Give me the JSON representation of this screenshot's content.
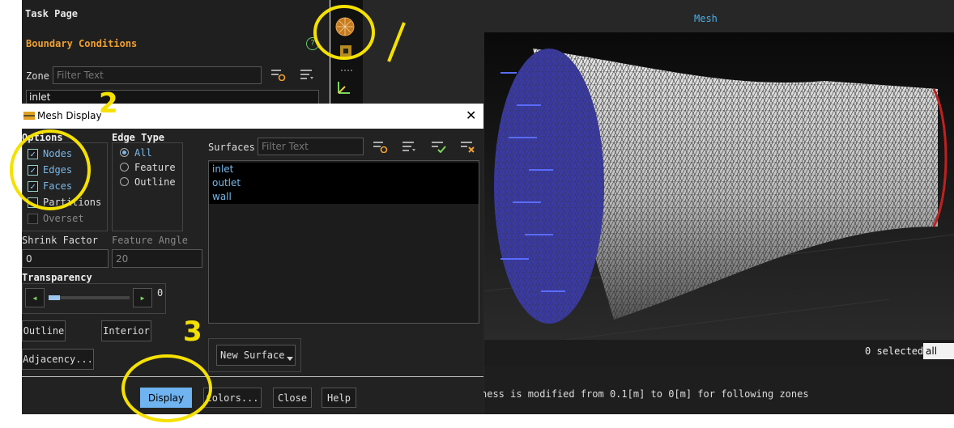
{
  "task_page": {
    "title": "Task Page",
    "section_title": "Boundary Conditions",
    "help_glyph": "?",
    "zone_label": "Zone",
    "zone_filter_placeholder": "Filter Text",
    "zone_list": [
      "inlet"
    ]
  },
  "graphics": {
    "title": "Mesh",
    "selected_text": "0 selected",
    "selection_filter": "all",
    "console_line": "ness is modified from 0.1[m] to 0[m] for following zones"
  },
  "dialog": {
    "title": "Mesh Display",
    "close_glyph": "✕",
    "options": {
      "label": "Options",
      "items": [
        {
          "label": "Nodes",
          "checked": true
        },
        {
          "label": "Edges",
          "checked": true
        },
        {
          "label": "Faces",
          "checked": true
        },
        {
          "label": "Partitions",
          "checked": false
        },
        {
          "label": "Overset",
          "checked": false
        }
      ]
    },
    "edge_type": {
      "label": "Edge Type",
      "items": [
        {
          "label": "All",
          "selected": true
        },
        {
          "label": "Feature",
          "selected": false
        },
        {
          "label": "Outline",
          "selected": false
        }
      ]
    },
    "shrink_factor": {
      "label": "Shrink Factor",
      "value": "0"
    },
    "feature_angle": {
      "label": "Feature Angle",
      "value": "20"
    },
    "transparency": {
      "label": "Transparency",
      "value": "0",
      "level": 0
    },
    "buttons": {
      "outline": "Outline",
      "interior": "Interior",
      "adjacency": "Adjacency...",
      "new_surface": "New Surface",
      "display": "Display",
      "colors": "Colors...",
      "close": "Close",
      "help": "Help"
    },
    "surfaces": {
      "label": "Surfaces",
      "filter_placeholder": "Filter Text",
      "items": [
        "inlet",
        "outlet",
        "wall"
      ]
    }
  },
  "annotations": [
    "1",
    "2",
    "3"
  ],
  "colors": {
    "accent": "#6fb3f0",
    "section_orange": "#f0a030",
    "annotation": "#f5e100",
    "inlet_blue": "#3a3aa8"
  }
}
